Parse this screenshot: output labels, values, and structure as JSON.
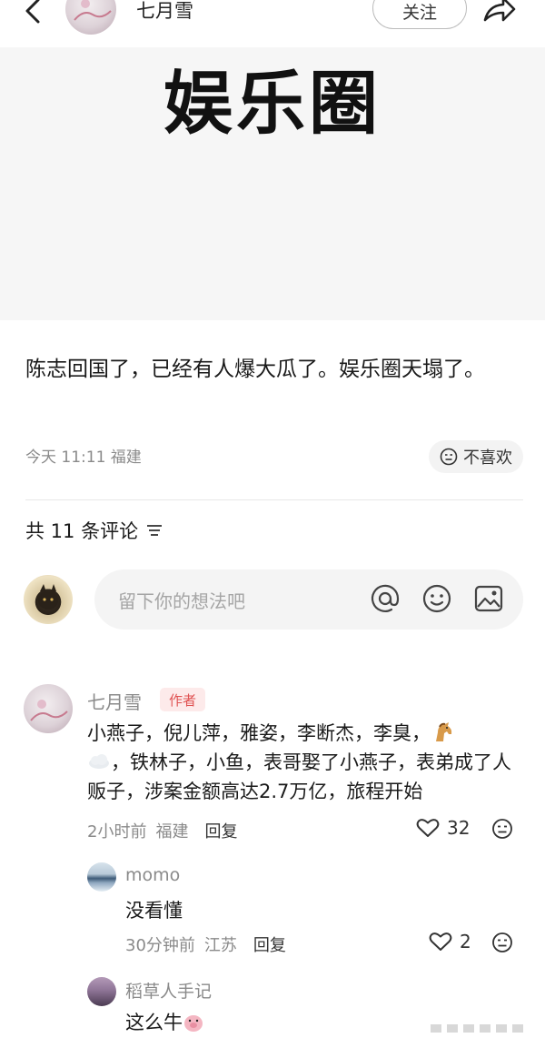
{
  "header": {
    "author_name": "七月雪",
    "follow_label": "关注",
    "back_icon": "chevron-left-icon",
    "share_icon": "share-icon"
  },
  "poster": {
    "title": "娱乐圈"
  },
  "post": {
    "text": "陈志回国了，已经有人爆大瓜了。娱乐圈天塌了。",
    "meta": "今天 11:11 福建",
    "dislike_label": "不喜欢"
  },
  "comments_header": {
    "count_label": "共 11 条评论"
  },
  "comment_input": {
    "placeholder": "留下你的想法吧"
  },
  "comments": [
    {
      "name": "七月雪",
      "badge": "作者",
      "text_part1": "小燕子，倪儿萍，雅姿，李断杰，李臭，",
      "text_part2": "，铁林子，小鱼，表哥娶了小燕子，表弟成了人贩子，涉案金额高达2.7万亿，旅程开始",
      "time": "2小时前",
      "location": "福建",
      "reply_label": "回复",
      "likes": "32"
    },
    {
      "name": "momo",
      "text": "没看懂",
      "time": "30分钟前",
      "location": "江苏",
      "reply_label": "回复",
      "likes": "2"
    },
    {
      "name": "稻草人手记",
      "text": "这么牛"
    }
  ],
  "colors": {
    "accent_badge": "#e05252",
    "badge_bg": "#fdeaea",
    "meta_gray": "#8a8a8a"
  }
}
